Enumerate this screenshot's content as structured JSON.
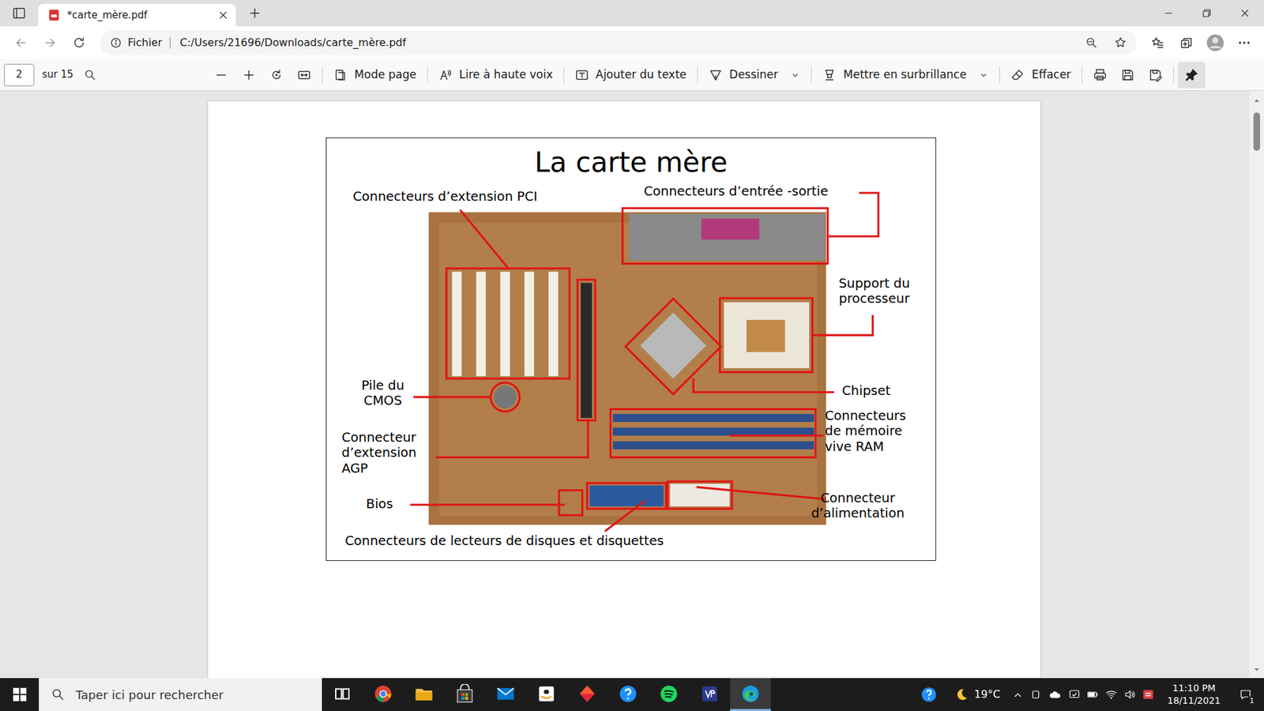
{
  "browser": {
    "tab": {
      "title": "*carte_mère.pdf",
      "selected": true
    },
    "address": {
      "scheme": "Fichier",
      "url": "C:/Users/21696/Downloads/carte_mère.pdf"
    }
  },
  "pdf_toolbar": {
    "page": "2",
    "page_count": "sur 15",
    "tools": [
      {
        "label": "Mode page",
        "kind": "button"
      },
      {
        "label": "Lire à haute voix",
        "kind": "button"
      },
      {
        "label": "Ajouter du texte",
        "kind": "button"
      },
      {
        "label": "Dessiner",
        "kind": "menu"
      },
      {
        "label": "Mettre en surbrillance",
        "kind": "menu"
      },
      {
        "label": "Effacer",
        "kind": "button"
      }
    ],
    "pinned": true
  },
  "document": {
    "title": "La carte mère",
    "labels": [
      {
        "text": "Connecteurs d’extension PCI"
      },
      {
        "text": "Connecteurs d’entrée -sortie"
      },
      {
        "text": "Support du\nprocesseur"
      },
      {
        "text": "Chipset"
      },
      {
        "text": "Connecteurs\nde mémoire\nvive RAM"
      },
      {
        "text": "Connecteur\nd’alimentation"
      },
      {
        "text": "Connecteurs de lecteurs de disques et disquettes"
      },
      {
        "text": "Bios"
      },
      {
        "text": "Connecteur\nd’extension\nAGP"
      },
      {
        "text": "Pile du\nCMOS"
      }
    ]
  },
  "taskbar": {
    "search": {
      "placeholder": "Taper ici pour rechercher"
    },
    "apps": [
      {
        "kind": "taskview",
        "selected": false
      },
      {
        "kind": "chrome",
        "selected": false
      },
      {
        "kind": "explorer",
        "selected": false
      },
      {
        "kind": "store",
        "selected": false
      },
      {
        "kind": "mail",
        "selected": false
      },
      {
        "kind": "amazon",
        "selected": false
      },
      {
        "kind": "anydo",
        "selected": false
      },
      {
        "kind": "help",
        "selected": false
      },
      {
        "kind": "spotify",
        "selected": false
      },
      {
        "kind": "vpn",
        "selected": false
      },
      {
        "kind": "edge",
        "selected": true
      }
    ],
    "weather": "19°C",
    "time": "11:10 PM",
    "date": "18/11/2021",
    "notifications": "1"
  }
}
